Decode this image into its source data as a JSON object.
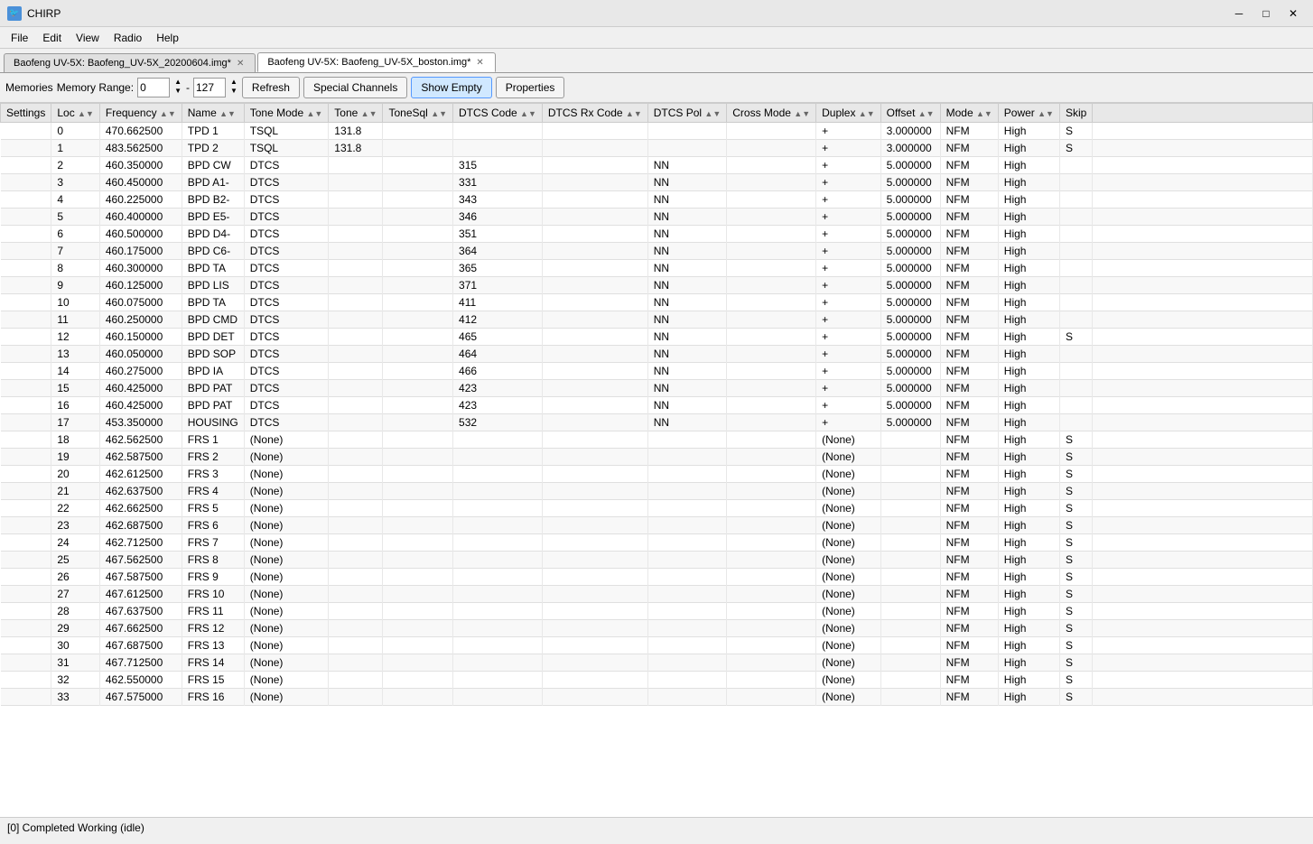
{
  "titleBar": {
    "icon": "🐦",
    "title": "CHIRP",
    "minimize": "─",
    "maximize": "□",
    "close": "✕"
  },
  "menu": {
    "items": [
      "File",
      "Edit",
      "View",
      "Radio",
      "Help"
    ]
  },
  "tabs": [
    {
      "label": "Baofeng UV-5X: Baofeng_UV-5X_20200604.img*",
      "active": false
    },
    {
      "label": "Baofeng UV-5X: Baofeng_UV-5X_boston.img*",
      "active": true
    }
  ],
  "toolbar": {
    "memoryLabel": "Memories",
    "memoryRangeLabel": "Memory Range:",
    "rangeStart": "0",
    "rangeSeparator": "-",
    "rangeEnd": "127",
    "refreshLabel": "Refresh",
    "specialChannelsLabel": "Special Channels",
    "showEmptyLabel": "Show Empty",
    "propertiesLabel": "Properties"
  },
  "tableHeaders": [
    "Settings",
    "Loc",
    "Frequency",
    "Name",
    "Tone Mode",
    "Tone",
    "ToneSql",
    "DTCS Code",
    "DTCS Rx Code",
    "DTCS Pol",
    "Cross Mode",
    "Duplex",
    "Offset",
    "Mode",
    "Power",
    "Skip"
  ],
  "rows": [
    {
      "loc": "0",
      "freq": "470.662500",
      "name": "TPD 1",
      "toneMode": "TSQL",
      "tone": "131.8",
      "toneSql": "",
      "dtcsCode": "",
      "dtcsRxCode": "",
      "dtcsPol": "",
      "crossMode": "",
      "duplex": "+",
      "offset": "3.000000",
      "mode": "NFM",
      "power": "High",
      "skip": "S"
    },
    {
      "loc": "1",
      "freq": "483.562500",
      "name": "TPD 2",
      "toneMode": "TSQL",
      "tone": "131.8",
      "toneSql": "",
      "dtcsCode": "",
      "dtcsRxCode": "",
      "dtcsPol": "",
      "crossMode": "",
      "duplex": "+",
      "offset": "3.000000",
      "mode": "NFM",
      "power": "High",
      "skip": "S"
    },
    {
      "loc": "2",
      "freq": "460.350000",
      "name": "BPD CW",
      "toneMode": "DTCS",
      "tone": "",
      "toneSql": "",
      "dtcsCode": "315",
      "dtcsRxCode": "",
      "dtcsPol": "NN",
      "crossMode": "",
      "duplex": "+",
      "offset": "5.000000",
      "mode": "NFM",
      "power": "High",
      "skip": ""
    },
    {
      "loc": "3",
      "freq": "460.450000",
      "name": "BPD A1-",
      "toneMode": "DTCS",
      "tone": "",
      "toneSql": "",
      "dtcsCode": "331",
      "dtcsRxCode": "",
      "dtcsPol": "NN",
      "crossMode": "",
      "duplex": "+",
      "offset": "5.000000",
      "mode": "NFM",
      "power": "High",
      "skip": ""
    },
    {
      "loc": "4",
      "freq": "460.225000",
      "name": "BPD B2-",
      "toneMode": "DTCS",
      "tone": "",
      "toneSql": "",
      "dtcsCode": "343",
      "dtcsRxCode": "",
      "dtcsPol": "NN",
      "crossMode": "",
      "duplex": "+",
      "offset": "5.000000",
      "mode": "NFM",
      "power": "High",
      "skip": ""
    },
    {
      "loc": "5",
      "freq": "460.400000",
      "name": "BPD E5-",
      "toneMode": "DTCS",
      "tone": "",
      "toneSql": "",
      "dtcsCode": "346",
      "dtcsRxCode": "",
      "dtcsPol": "NN",
      "crossMode": "",
      "duplex": "+",
      "offset": "5.000000",
      "mode": "NFM",
      "power": "High",
      "skip": ""
    },
    {
      "loc": "6",
      "freq": "460.500000",
      "name": "BPD D4-",
      "toneMode": "DTCS",
      "tone": "",
      "toneSql": "",
      "dtcsCode": "351",
      "dtcsRxCode": "",
      "dtcsPol": "NN",
      "crossMode": "",
      "duplex": "+",
      "offset": "5.000000",
      "mode": "NFM",
      "power": "High",
      "skip": ""
    },
    {
      "loc": "7",
      "freq": "460.175000",
      "name": "BPD C6-",
      "toneMode": "DTCS",
      "tone": "",
      "toneSql": "",
      "dtcsCode": "364",
      "dtcsRxCode": "",
      "dtcsPol": "NN",
      "crossMode": "",
      "duplex": "+",
      "offset": "5.000000",
      "mode": "NFM",
      "power": "High",
      "skip": ""
    },
    {
      "loc": "8",
      "freq": "460.300000",
      "name": "BPD TA",
      "toneMode": "DTCS",
      "tone": "",
      "toneSql": "",
      "dtcsCode": "365",
      "dtcsRxCode": "",
      "dtcsPol": "NN",
      "crossMode": "",
      "duplex": "+",
      "offset": "5.000000",
      "mode": "NFM",
      "power": "High",
      "skip": ""
    },
    {
      "loc": "9",
      "freq": "460.125000",
      "name": "BPD LIS",
      "toneMode": "DTCS",
      "tone": "",
      "toneSql": "",
      "dtcsCode": "371",
      "dtcsRxCode": "",
      "dtcsPol": "NN",
      "crossMode": "",
      "duplex": "+",
      "offset": "5.000000",
      "mode": "NFM",
      "power": "High",
      "skip": ""
    },
    {
      "loc": "10",
      "freq": "460.075000",
      "name": "BPD TA",
      "toneMode": "DTCS",
      "tone": "",
      "toneSql": "",
      "dtcsCode": "411",
      "dtcsRxCode": "",
      "dtcsPol": "NN",
      "crossMode": "",
      "duplex": "+",
      "offset": "5.000000",
      "mode": "NFM",
      "power": "High",
      "skip": ""
    },
    {
      "loc": "11",
      "freq": "460.250000",
      "name": "BPD CMD",
      "toneMode": "DTCS",
      "tone": "",
      "toneSql": "",
      "dtcsCode": "412",
      "dtcsRxCode": "",
      "dtcsPol": "NN",
      "crossMode": "",
      "duplex": "+",
      "offset": "5.000000",
      "mode": "NFM",
      "power": "High",
      "skip": ""
    },
    {
      "loc": "12",
      "freq": "460.150000",
      "name": "BPD DET",
      "toneMode": "DTCS",
      "tone": "",
      "toneSql": "",
      "dtcsCode": "465",
      "dtcsRxCode": "",
      "dtcsPol": "NN",
      "crossMode": "",
      "duplex": "+",
      "offset": "5.000000",
      "mode": "NFM",
      "power": "High",
      "skip": "S"
    },
    {
      "loc": "13",
      "freq": "460.050000",
      "name": "BPD SOP",
      "toneMode": "DTCS",
      "tone": "",
      "toneSql": "",
      "dtcsCode": "464",
      "dtcsRxCode": "",
      "dtcsPol": "NN",
      "crossMode": "",
      "duplex": "+",
      "offset": "5.000000",
      "mode": "NFM",
      "power": "High",
      "skip": ""
    },
    {
      "loc": "14",
      "freq": "460.275000",
      "name": "BPD IA",
      "toneMode": "DTCS",
      "tone": "",
      "toneSql": "",
      "dtcsCode": "466",
      "dtcsRxCode": "",
      "dtcsPol": "NN",
      "crossMode": "",
      "duplex": "+",
      "offset": "5.000000",
      "mode": "NFM",
      "power": "High",
      "skip": ""
    },
    {
      "loc": "15",
      "freq": "460.425000",
      "name": "BPD PAT",
      "toneMode": "DTCS",
      "tone": "",
      "toneSql": "",
      "dtcsCode": "423",
      "dtcsRxCode": "",
      "dtcsPol": "NN",
      "crossMode": "",
      "duplex": "+",
      "offset": "5.000000",
      "mode": "NFM",
      "power": "High",
      "skip": ""
    },
    {
      "loc": "16",
      "freq": "460.425000",
      "name": "BPD PAT",
      "toneMode": "DTCS",
      "tone": "",
      "toneSql": "",
      "dtcsCode": "423",
      "dtcsRxCode": "",
      "dtcsPol": "NN",
      "crossMode": "",
      "duplex": "+",
      "offset": "5.000000",
      "mode": "NFM",
      "power": "High",
      "skip": ""
    },
    {
      "loc": "17",
      "freq": "453.350000",
      "name": "HOUSING",
      "toneMode": "DTCS",
      "tone": "",
      "toneSql": "",
      "dtcsCode": "532",
      "dtcsRxCode": "",
      "dtcsPol": "NN",
      "crossMode": "",
      "duplex": "+",
      "offset": "5.000000",
      "mode": "NFM",
      "power": "High",
      "skip": ""
    },
    {
      "loc": "18",
      "freq": "462.562500",
      "name": "FRS 1",
      "toneMode": "(None)",
      "tone": "",
      "toneSql": "",
      "dtcsCode": "",
      "dtcsRxCode": "",
      "dtcsPol": "",
      "crossMode": "",
      "duplex": "(None)",
      "offset": "",
      "mode": "NFM",
      "power": "High",
      "skip": "S"
    },
    {
      "loc": "19",
      "freq": "462.587500",
      "name": "FRS 2",
      "toneMode": "(None)",
      "tone": "",
      "toneSql": "",
      "dtcsCode": "",
      "dtcsRxCode": "",
      "dtcsPol": "",
      "crossMode": "",
      "duplex": "(None)",
      "offset": "",
      "mode": "NFM",
      "power": "High",
      "skip": "S"
    },
    {
      "loc": "20",
      "freq": "462.612500",
      "name": "FRS 3",
      "toneMode": "(None)",
      "tone": "",
      "toneSql": "",
      "dtcsCode": "",
      "dtcsRxCode": "",
      "dtcsPol": "",
      "crossMode": "",
      "duplex": "(None)",
      "offset": "",
      "mode": "NFM",
      "power": "High",
      "skip": "S"
    },
    {
      "loc": "21",
      "freq": "462.637500",
      "name": "FRS 4",
      "toneMode": "(None)",
      "tone": "",
      "toneSql": "",
      "dtcsCode": "",
      "dtcsRxCode": "",
      "dtcsPol": "",
      "crossMode": "",
      "duplex": "(None)",
      "offset": "",
      "mode": "NFM",
      "power": "High",
      "skip": "S"
    },
    {
      "loc": "22",
      "freq": "462.662500",
      "name": "FRS 5",
      "toneMode": "(None)",
      "tone": "",
      "toneSql": "",
      "dtcsCode": "",
      "dtcsRxCode": "",
      "dtcsPol": "",
      "crossMode": "",
      "duplex": "(None)",
      "offset": "",
      "mode": "NFM",
      "power": "High",
      "skip": "S"
    },
    {
      "loc": "23",
      "freq": "462.687500",
      "name": "FRS 6",
      "toneMode": "(None)",
      "tone": "",
      "toneSql": "",
      "dtcsCode": "",
      "dtcsRxCode": "",
      "dtcsPol": "",
      "crossMode": "",
      "duplex": "(None)",
      "offset": "",
      "mode": "NFM",
      "power": "High",
      "skip": "S"
    },
    {
      "loc": "24",
      "freq": "462.712500",
      "name": "FRS 7",
      "toneMode": "(None)",
      "tone": "",
      "toneSql": "",
      "dtcsCode": "",
      "dtcsRxCode": "",
      "dtcsPol": "",
      "crossMode": "",
      "duplex": "(None)",
      "offset": "",
      "mode": "NFM",
      "power": "High",
      "skip": "S"
    },
    {
      "loc": "25",
      "freq": "467.562500",
      "name": "FRS 8",
      "toneMode": "(None)",
      "tone": "",
      "toneSql": "",
      "dtcsCode": "",
      "dtcsRxCode": "",
      "dtcsPol": "",
      "crossMode": "",
      "duplex": "(None)",
      "offset": "",
      "mode": "NFM",
      "power": "High",
      "skip": "S"
    },
    {
      "loc": "26",
      "freq": "467.587500",
      "name": "FRS 9",
      "toneMode": "(None)",
      "tone": "",
      "toneSql": "",
      "dtcsCode": "",
      "dtcsRxCode": "",
      "dtcsPol": "",
      "crossMode": "",
      "duplex": "(None)",
      "offset": "",
      "mode": "NFM",
      "power": "High",
      "skip": "S"
    },
    {
      "loc": "27",
      "freq": "467.612500",
      "name": "FRS 10",
      "toneMode": "(None)",
      "tone": "",
      "toneSql": "",
      "dtcsCode": "",
      "dtcsRxCode": "",
      "dtcsPol": "",
      "crossMode": "",
      "duplex": "(None)",
      "offset": "",
      "mode": "NFM",
      "power": "High",
      "skip": "S"
    },
    {
      "loc": "28",
      "freq": "467.637500",
      "name": "FRS 11",
      "toneMode": "(None)",
      "tone": "",
      "toneSql": "",
      "dtcsCode": "",
      "dtcsRxCode": "",
      "dtcsPol": "",
      "crossMode": "",
      "duplex": "(None)",
      "offset": "",
      "mode": "NFM",
      "power": "High",
      "skip": "S"
    },
    {
      "loc": "29",
      "freq": "467.662500",
      "name": "FRS 12",
      "toneMode": "(None)",
      "tone": "",
      "toneSql": "",
      "dtcsCode": "",
      "dtcsRxCode": "",
      "dtcsPol": "",
      "crossMode": "",
      "duplex": "(None)",
      "offset": "",
      "mode": "NFM",
      "power": "High",
      "skip": "S"
    },
    {
      "loc": "30",
      "freq": "467.687500",
      "name": "FRS 13",
      "toneMode": "(None)",
      "tone": "",
      "toneSql": "",
      "dtcsCode": "",
      "dtcsRxCode": "",
      "dtcsPol": "",
      "crossMode": "",
      "duplex": "(None)",
      "offset": "",
      "mode": "NFM",
      "power": "High",
      "skip": "S"
    },
    {
      "loc": "31",
      "freq": "467.712500",
      "name": "FRS 14",
      "toneMode": "(None)",
      "tone": "",
      "toneSql": "",
      "dtcsCode": "",
      "dtcsRxCode": "",
      "dtcsPol": "",
      "crossMode": "",
      "duplex": "(None)",
      "offset": "",
      "mode": "NFM",
      "power": "High",
      "skip": "S"
    },
    {
      "loc": "32",
      "freq": "462.550000",
      "name": "FRS 15",
      "toneMode": "(None)",
      "tone": "",
      "toneSql": "",
      "dtcsCode": "",
      "dtcsRxCode": "",
      "dtcsPol": "",
      "crossMode": "",
      "duplex": "(None)",
      "offset": "",
      "mode": "NFM",
      "power": "High",
      "skip": "S"
    },
    {
      "loc": "33",
      "freq": "467.575000",
      "name": "FRS 16",
      "toneMode": "(None)",
      "tone": "",
      "toneSql": "",
      "dtcsCode": "",
      "dtcsRxCode": "",
      "dtcsPol": "",
      "crossMode": "",
      "duplex": "(None)",
      "offset": "",
      "mode": "NFM",
      "power": "High",
      "skip": "S"
    }
  ],
  "statusBar": {
    "text": "[0] Completed Working (idle)"
  }
}
